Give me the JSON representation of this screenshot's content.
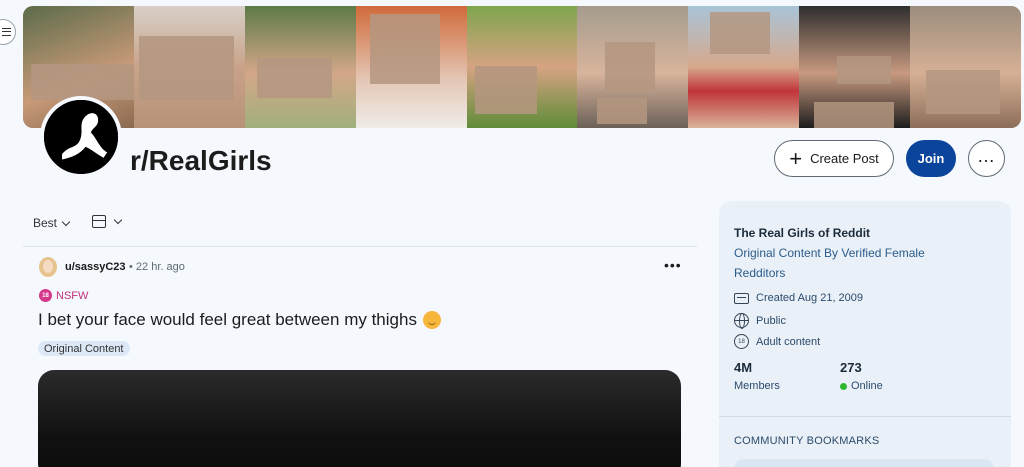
{
  "subreddit": {
    "name": "r/RealGirls",
    "avatar_icon": "silhouette-avatar-icon"
  },
  "header_actions": {
    "create_post_label": "Create Post",
    "join_label": "Join",
    "more_icon": "ellipsis-icon"
  },
  "feed_controls": {
    "sort_label": "Best",
    "view_icon": "card-view-icon"
  },
  "post": {
    "author": "u/sassyC23",
    "time": "• 22 hr. ago",
    "nsfw_label": "NSFW",
    "nsfw_icon_text": "18",
    "title": "I bet your face would feel great between my thighs",
    "emoji_icon": "blushing-face-icon",
    "flair": "Original Content"
  },
  "sidebar": {
    "title": "The Real Girls of Reddit",
    "description": "Original Content By Verified Female Redditors",
    "created": "Created Aug 21, 2009",
    "visibility": "Public",
    "content_rating": "Adult content",
    "rating_icon_text": "18",
    "members_count": "4M",
    "members_label": "Members",
    "online_count": "273",
    "online_label": "Online",
    "bookmarks_heading": "COMMUNITY BOOKMARKS"
  },
  "colors": {
    "page_bg": "#f5f8fd",
    "join_button": "#0a449b",
    "nsfw": "#d6388b",
    "sidebar_bg": "#eaf0f8",
    "online": "#2eb82e"
  }
}
